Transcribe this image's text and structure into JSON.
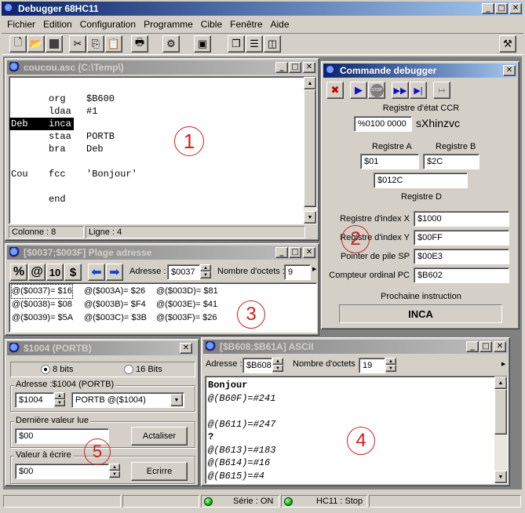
{
  "app": {
    "title": "Debugger 68HC11"
  },
  "menu": [
    "Fichier",
    "Edition",
    "Configuration",
    "Programme",
    "Cible",
    "Fenêtre",
    "Aide"
  ],
  "source_window": {
    "title": "coucou.asc (C:\\Temp\\)",
    "lines": [
      {
        "label": "",
        "op": "",
        "arg": "",
        "hl": false
      },
      {
        "label": "",
        "op": "org",
        "arg": "$B600",
        "hl": false
      },
      {
        "label": "",
        "op": "ldaa",
        "arg": "#1",
        "hl": false
      },
      {
        "label": "Deb",
        "op": "inca",
        "arg": "",
        "hl": true
      },
      {
        "label": "",
        "op": "staa",
        "arg": "PORTB",
        "hl": false
      },
      {
        "label": "",
        "op": "bra",
        "arg": "Deb",
        "hl": false
      },
      {
        "label": "",
        "op": "",
        "arg": "",
        "hl": false
      },
      {
        "label": "Cou",
        "op": "fcc",
        "arg": "'Bonjour'",
        "hl": false
      },
      {
        "label": "",
        "op": "",
        "arg": "",
        "hl": false
      },
      {
        "label": "",
        "op": "end",
        "arg": "",
        "hl": false
      }
    ],
    "status_col": "Colonne : 8",
    "status_line": "Ligne : 4",
    "annotation": "1"
  },
  "debug_window": {
    "title": "Commande debugger",
    "ccr_label": "Registre d'état CCR",
    "ccr_value": "%0100 0000",
    "ccr_flags": "sXhinzvc",
    "reg_a_label": "Registre A",
    "reg_a_value": "$01",
    "reg_b_label": "Registre B",
    "reg_b_value": "$2C",
    "reg_d_value": "$012C",
    "reg_d_label": "Registre D",
    "reg_x_label": "Registre d'index X",
    "reg_x_value": "$1000",
    "reg_y_label": "Registre d'index Y",
    "reg_y_value": "$00FF",
    "sp_label": "Pointer de pile SP",
    "sp_value": "$00E3",
    "pc_label": "Compteur ordinal PC",
    "pc_value": "$B602",
    "next_label": "Prochaine instruction",
    "next_value": "INCA",
    "stop_label": "STOP",
    "annotation": "2"
  },
  "range_window": {
    "title": "[$0037;$003F] Plage adresse",
    "btn_percent": "%",
    "btn_at": "@",
    "btn_10": "10",
    "btn_dollar": "$",
    "address_label": "Adresse :",
    "address_value": "$0037",
    "bytes_label": "Nombre d'octets :",
    "bytes_value": "9",
    "rows": [
      [
        "@($0037)= $16",
        "@($003A)= $26",
        "@($003D)= $81"
      ],
      [
        "@($0038)= $08",
        "@($003B)= $F4",
        "@($003E)= $41"
      ],
      [
        "@($0039)= $5A",
        "@($003C)= $3B",
        "@($003F)= $26"
      ]
    ],
    "annotation": "3"
  },
  "ascii_window": {
    "title": "[$B608;$B61A] ASCII",
    "address_label": "Adresse :",
    "address_value": "$B608",
    "bytes_label": "Nombre d'octets :",
    "bytes_value": "19",
    "lines": [
      {
        "text": "Bonjour",
        "italic": false
      },
      {
        "text": "@(B60F)=#241",
        "italic": true
      },
      {
        "text": "",
        "italic": false
      },
      {
        "text": "@(B611)=#247",
        "italic": true
      },
      {
        "text": "?",
        "italic": false
      },
      {
        "text": "@(B613)=#183",
        "italic": true
      },
      {
        "text": "@(B614)=#16",
        "italic": true
      },
      {
        "text": "@(B615)=#4",
        "italic": true
      }
    ],
    "annotation": "4"
  },
  "port_window": {
    "title": "$1004 (PORTB)",
    "radio_8": "8 bits",
    "radio_16": "16 Bits",
    "address_group": "Adresse :$1004 (PORTB)",
    "address_value": "$1004",
    "address_select": "PORTB  @($1004)",
    "last_group": "Dernière  valeur lue",
    "last_value": "$00",
    "refresh_button": "Actaliser",
    "write_group": "Valeur à écrire",
    "write_value": "$00",
    "write_button": "Ecrirre",
    "annotation": "5"
  },
  "status": {
    "serial": "Série : ON",
    "target": "HC11 : Stop"
  },
  "colors": {
    "title_active": "#0a246a",
    "annotation": "#d02020",
    "led": "#00a000"
  }
}
